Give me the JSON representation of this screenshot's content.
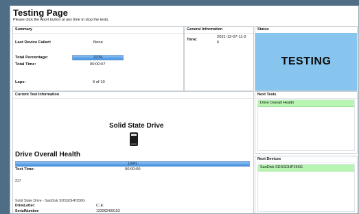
{
  "page": {
    "title": "Testing Page",
    "subtitle": "Please click the Abort button at any time to stop the tests."
  },
  "summary": {
    "header": "Summary",
    "last_device_failed_label": "Last Device Failed:",
    "last_device_failed_value": "None",
    "total_percentage_label": "Total Percentage:",
    "total_percentage_value": "100%",
    "total_percentage_fraction": 1.0,
    "total_time_label": "Total Time:",
    "total_time_value": "00:00:07",
    "laps_label": "Laps:",
    "laps_value": "9 of 10"
  },
  "general": {
    "header": "General Information",
    "time_label": "Time:",
    "time_value_line1": "2021-12-07-11-2",
    "time_value_line2": "6"
  },
  "status": {
    "header": "Status",
    "text": "TESTING",
    "color": "#87c5ee"
  },
  "current_test": {
    "header": "Current Test Information",
    "device_type": "Solid State Drive",
    "test_name": "Drive Overall Health",
    "progress_value": "100%",
    "progress_fraction": 1.0,
    "test_time_label": "Test Time:",
    "test_time_value": "00:00:00",
    "counter": "317",
    "device_desc": "Solid State Drive - SanDisk SDSSDHP256G",
    "drive_letter_label": "DriveLetter:",
    "drive_letter_value": "C:,E:",
    "serial_label": "SerialNumber:",
    "serial_value": "122062400153"
  },
  "next_tests": {
    "header": "Next Tests",
    "items": [
      "Drive Overall Health"
    ]
  },
  "next_devices": {
    "header": "Next Devices",
    "items": [
      "SanDisk SDSSDHP256G"
    ]
  },
  "colors": {
    "background": "#4f6e86",
    "progress": "#3f8fe0",
    "list_highlight": "#b8f5b3"
  }
}
